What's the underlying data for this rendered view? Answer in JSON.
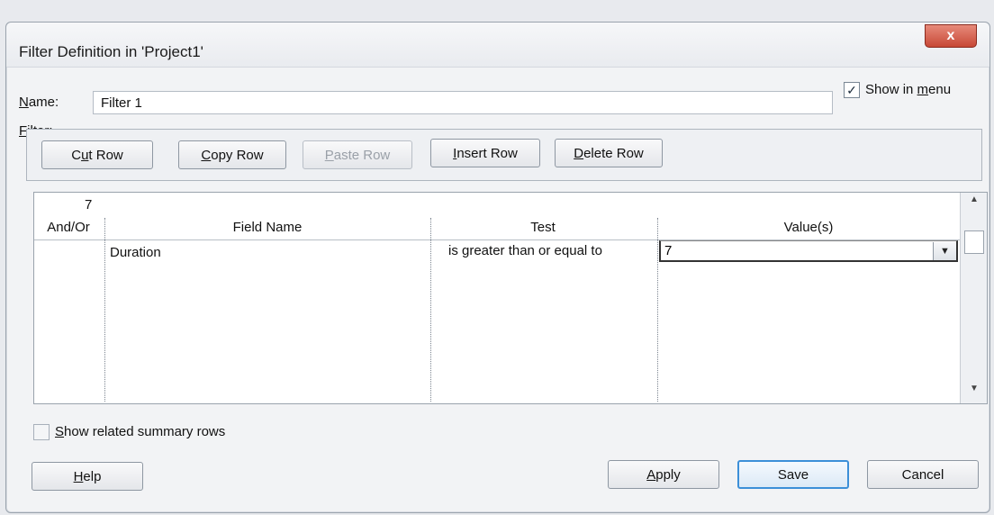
{
  "window": {
    "title": "Filter Definition in 'Project1'",
    "close_label": "x"
  },
  "name_field": {
    "label_prefix": "N",
    "label_rest": "ame:",
    "value": "Filter 1"
  },
  "show_in_menu": {
    "checked": true,
    "check_glyph": "✓",
    "label_prefix": "Show in ",
    "label_accel": "m",
    "label_rest": "enu"
  },
  "filter_label": {
    "accel": "F",
    "rest": "ilter:"
  },
  "toolbar": {
    "cut_row": {
      "pre": "C",
      "accel": "u",
      "post": "t Row"
    },
    "copy_row": {
      "pre": "",
      "accel": "C",
      "post": "opy Row"
    },
    "paste_row": {
      "pre": "",
      "accel": "P",
      "post": "aste Row"
    },
    "insert_row": {
      "pre": "",
      "accel": "I",
      "post": "nsert Row"
    },
    "delete_row": {
      "pre": "",
      "accel": "D",
      "post": "elete Row"
    }
  },
  "grid": {
    "row_indicator": "7",
    "columns": [
      "And/Or",
      "Field Name",
      "Test",
      "Value(s)"
    ],
    "rows": [
      {
        "and_or": "",
        "field_name": "Duration",
        "test": "is greater than or equal to",
        "value": "7"
      }
    ],
    "scroll_up": "▲",
    "scroll_down": "▼",
    "dropdown_glyph": "▼"
  },
  "summary_rows": {
    "checked": false,
    "accel": "S",
    "rest": "how related summary rows"
  },
  "footer": {
    "help": {
      "accel": "H",
      "rest": "elp"
    },
    "apply": {
      "accel": "A",
      "rest": "pply"
    },
    "save": "Save",
    "cancel": "Cancel"
  }
}
